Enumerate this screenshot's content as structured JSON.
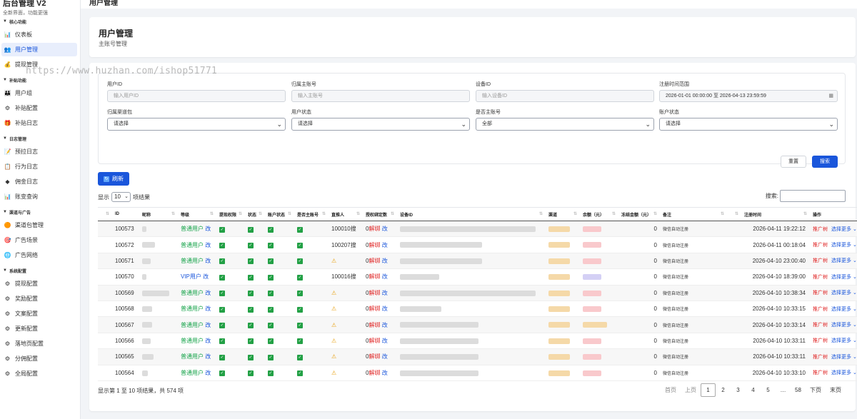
{
  "brand": {
    "title": "后台管理 V2",
    "subtitle": "全新界面，功能更强"
  },
  "topbar": {
    "title": "用户管理",
    "items": [
      "",
      "",
      ""
    ],
    "logout": ""
  },
  "sidebar": {
    "sections": [
      {
        "title": "核心功能",
        "items": [
          {
            "label": "仪表板",
            "icon": "chart-icon",
            "glyph": "📊"
          },
          {
            "label": "用户管理",
            "icon": "users-icon",
            "glyph": "👥",
            "active": true
          },
          {
            "label": "提现管理",
            "icon": "withdraw-icon",
            "glyph": "💰"
          }
        ]
      },
      {
        "title": "补贴功能",
        "items": [
          {
            "label": "用户组",
            "icon": "group-icon",
            "glyph": "👪"
          },
          {
            "label": "补贴配置",
            "icon": "gear-icon",
            "glyph": "⚙"
          },
          {
            "label": "补贴日志",
            "icon": "gift-icon",
            "glyph": "🎁"
          }
        ]
      },
      {
        "title": "日志管理",
        "items": [
          {
            "label": "预拉日志",
            "icon": "note-icon",
            "glyph": "📝"
          },
          {
            "label": "行为日志",
            "icon": "log-icon",
            "glyph": "📋"
          },
          {
            "label": "佣金日志",
            "icon": "diamond-icon",
            "glyph": "◆"
          },
          {
            "label": "账变查询",
            "icon": "chart-icon",
            "glyph": "📊"
          }
        ]
      },
      {
        "title": "渠道与广告",
        "items": [
          {
            "label": "渠道包管理",
            "icon": "package-icon",
            "glyph": "🟠"
          },
          {
            "label": "广告场景",
            "icon": "target-icon",
            "glyph": "🎯"
          },
          {
            "label": "广告网络",
            "icon": "globe-icon",
            "glyph": "🌐"
          }
        ]
      },
      {
        "title": "系统配置",
        "items": [
          {
            "label": "提现配置",
            "icon": "gear-icon",
            "glyph": "⚙"
          },
          {
            "label": "奖励配置",
            "icon": "gear-icon",
            "glyph": "⚙"
          },
          {
            "label": "文案配置",
            "icon": "gear-icon",
            "glyph": "⚙"
          },
          {
            "label": "更新配置",
            "icon": "gear-icon",
            "glyph": "⚙"
          },
          {
            "label": "落地页配置",
            "icon": "gear-icon",
            "glyph": "⚙"
          },
          {
            "label": "分佣配置",
            "icon": "gear-icon",
            "glyph": "⚙"
          },
          {
            "label": "全局配置",
            "icon": "gear-icon",
            "glyph": "⚙"
          }
        ]
      }
    ]
  },
  "header": {
    "title": "用户管理",
    "subtitle": "主账号管理"
  },
  "filters": {
    "user_id": {
      "label": "用户ID",
      "placeholder": "输入用户ID"
    },
    "main_account": {
      "label": "归属主账号",
      "placeholder": "输入主账号"
    },
    "device_id": {
      "label": "设备ID",
      "placeholder": "输入设备ID"
    },
    "reg_range": {
      "label": "注册时间范围",
      "value": "2026-01-01 00:00:00 至 2026-04-13 23:59:59"
    },
    "channel": {
      "label": "归属渠道包",
      "value": "请选择"
    },
    "user_status": {
      "label": "用户状态",
      "value": "请选择"
    },
    "is_main": {
      "label": "是否主账号",
      "value": "全部"
    },
    "account_status": {
      "label": "账户状态",
      "value": "请选择"
    },
    "reset_label": "重置",
    "search_label": "搜索"
  },
  "refresh_label": "刷新",
  "length": {
    "prefix": "显示",
    "value": "10",
    "suffix": "项结果"
  },
  "search_label": "搜索:",
  "table": {
    "headers": [
      "",
      "ID",
      "昵称",
      "等级",
      "提现权限",
      "状态",
      "账户状态",
      "是否主账号",
      "直推人",
      "授权绑定数",
      "设备ID",
      "渠道",
      "余额（元）",
      "冻结金额（元）",
      "备注",
      "",
      "注册时间",
      "操作"
    ],
    "rows": [
      {
        "id": "100573",
        "level": "普通用户",
        "vip": false,
        "inviter": "100010搜",
        "warn": false,
        "bind": "0",
        "balance_color": "pink",
        "frozen": "0",
        "remark": "微信自动注册",
        "time": "2026-04-11 19:22:12"
      },
      {
        "id": "100572",
        "level": "普通用户",
        "vip": false,
        "inviter": "100207搜",
        "warn": false,
        "bind": "0",
        "balance_color": "pink",
        "frozen": "0",
        "remark": "微信自动注册",
        "time": "2026-04-11 00:18:04"
      },
      {
        "id": "100571",
        "level": "普通用户",
        "vip": false,
        "inviter": "",
        "warn": true,
        "bind": "0",
        "balance_color": "pink",
        "frozen": "0",
        "remark": "微信自动注册",
        "time": "2026-04-10 23:00:40"
      },
      {
        "id": "100570",
        "level": "VIP用户",
        "vip": true,
        "inviter": "100016搜",
        "warn": false,
        "bind": "0",
        "balance_color": "purple",
        "frozen": "0",
        "remark": "微信自动注册",
        "time": "2026-04-10 18:39:00"
      },
      {
        "id": "100569",
        "level": "普通用户",
        "vip": false,
        "inviter": "",
        "warn": true,
        "bind": "0",
        "balance_color": "pink",
        "frozen": "0",
        "remark": "微信自动注册",
        "time": "2026-04-10 10:38:34"
      },
      {
        "id": "100568",
        "level": "普通用户",
        "vip": false,
        "inviter": "",
        "warn": true,
        "bind": "0",
        "balance_color": "pink",
        "frozen": "0",
        "remark": "微信自动注册",
        "time": "2026-04-10 10:33:15"
      },
      {
        "id": "100567",
        "level": "普通用户",
        "vip": false,
        "inviter": "",
        "warn": true,
        "bind": "0",
        "balance_color": "orange",
        "frozen": "0",
        "remark": "微信自动注册",
        "time": "2026-04-10 10:33:14"
      },
      {
        "id": "100566",
        "level": "普通用户",
        "vip": false,
        "inviter": "",
        "warn": true,
        "bind": "0",
        "balance_color": "pink",
        "frozen": "0",
        "remark": "微信自动注册",
        "time": "2026-04-10 10:33:11"
      },
      {
        "id": "100565",
        "level": "普通用户",
        "vip": false,
        "inviter": "",
        "warn": true,
        "bind": "0",
        "balance_color": "pink",
        "frozen": "0",
        "remark": "微信自动注册",
        "time": "2026-04-10 10:33:11"
      },
      {
        "id": "100564",
        "level": "普通用户",
        "vip": false,
        "inviter": "",
        "warn": true,
        "bind": "0",
        "balance_color": "pink",
        "frozen": "0",
        "remark": "微信自动注册",
        "time": "2026-04-10 10:33:10"
      }
    ],
    "edit_label": "改",
    "unbind_label": "解绑",
    "promote_label": "推广树",
    "more_label": "选择更多"
  },
  "footer": {
    "info": "显示第 1 至 10 项结果，共 574 项",
    "pages": [
      "首页",
      "上页",
      "1",
      "2",
      "3",
      "4",
      "5",
      "…",
      "58",
      "下页",
      "末页"
    ],
    "current": "1"
  },
  "watermark": "https://www.huzhan.com/ishop51771",
  "colors": {
    "primary": "#1a56db",
    "success": "#16a34a",
    "danger": "#e02424",
    "warning": "#e8a317"
  }
}
